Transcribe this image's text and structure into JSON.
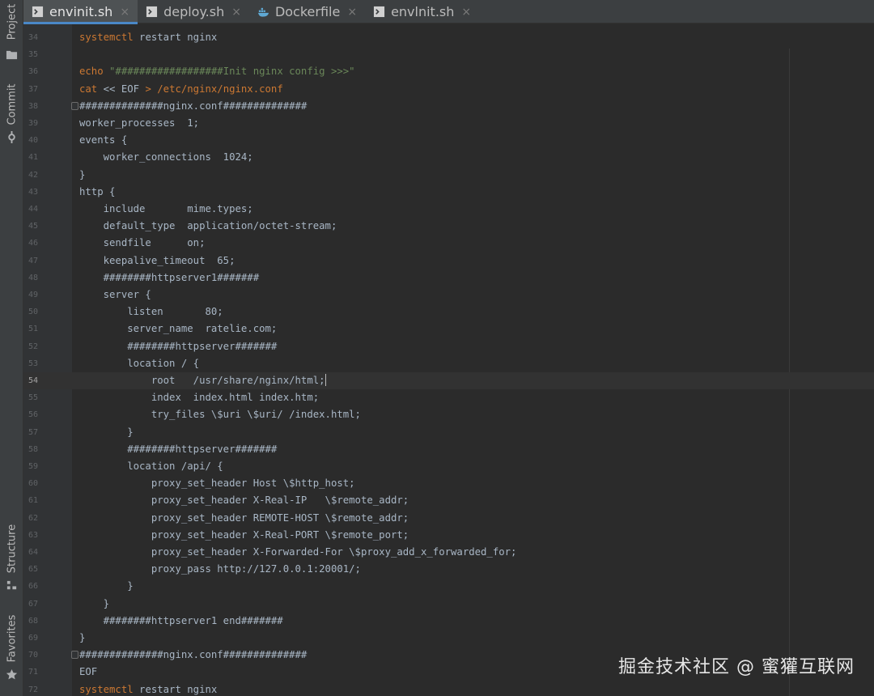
{
  "tabs": [
    {
      "label": "envinit.sh",
      "icon": "terminal-file-icon",
      "active": true
    },
    {
      "label": "deploy.sh",
      "icon": "terminal-file-icon",
      "active": false
    },
    {
      "label": "Dockerfile",
      "icon": "docker-file-icon",
      "active": false
    },
    {
      "label": "envlnit.sh",
      "icon": "terminal-file-icon",
      "active": false
    }
  ],
  "sidebar": {
    "project": "Project",
    "commit": "Commit",
    "structure": "Structure",
    "favorites": "Favorites"
  },
  "editor": {
    "current_line": 54,
    "lines": [
      {
        "n": "34",
        "parts": [
          {
            "t": "systemctl",
            "c": "kw"
          },
          {
            "t": " restart nginx",
            "c": ""
          }
        ]
      },
      {
        "n": "35",
        "parts": []
      },
      {
        "n": "36",
        "parts": [
          {
            "t": "echo",
            "c": "kw"
          },
          {
            "t": " \"##################Init nginx config >>>\"",
            "c": "str"
          }
        ]
      },
      {
        "n": "37",
        "parts": [
          {
            "t": "cat",
            "c": "kw"
          },
          {
            "t": " << EOF ",
            "c": ""
          },
          {
            "t": "> /etc/nginx/nginx.conf",
            "c": "kw"
          }
        ]
      },
      {
        "n": "38",
        "fold": true,
        "parts": [
          {
            "t": "##############nginx.conf##############",
            "c": ""
          }
        ]
      },
      {
        "n": "39",
        "parts": [
          {
            "t": "worker_processes  1;",
            "c": ""
          }
        ]
      },
      {
        "n": "40",
        "parts": [
          {
            "t": "events {",
            "c": ""
          }
        ]
      },
      {
        "n": "41",
        "parts": [
          {
            "t": "    worker_connections  1024;",
            "c": ""
          }
        ]
      },
      {
        "n": "42",
        "parts": [
          {
            "t": "}",
            "c": ""
          }
        ]
      },
      {
        "n": "43",
        "parts": [
          {
            "t": "http {",
            "c": ""
          }
        ]
      },
      {
        "n": "44",
        "parts": [
          {
            "t": "    include       mime.types;",
            "c": ""
          }
        ]
      },
      {
        "n": "45",
        "parts": [
          {
            "t": "    default_type  application/octet-stream;",
            "c": ""
          }
        ]
      },
      {
        "n": "46",
        "parts": [
          {
            "t": "    sendfile      on;",
            "c": ""
          }
        ]
      },
      {
        "n": "47",
        "parts": [
          {
            "t": "    keepalive_timeout  65;",
            "c": ""
          }
        ]
      },
      {
        "n": "48",
        "parts": [
          {
            "t": "    ########httpserver1#######",
            "c": ""
          }
        ]
      },
      {
        "n": "49",
        "parts": [
          {
            "t": "    server {",
            "c": ""
          }
        ]
      },
      {
        "n": "50",
        "parts": [
          {
            "t": "        listen       80;",
            "c": ""
          }
        ]
      },
      {
        "n": "51",
        "parts": [
          {
            "t": "        server_name  ratelie.com;",
            "c": ""
          }
        ]
      },
      {
        "n": "52",
        "parts": [
          {
            "t": "        ########httpserver#######",
            "c": ""
          }
        ]
      },
      {
        "n": "53",
        "parts": [
          {
            "t": "        location / {",
            "c": ""
          }
        ]
      },
      {
        "n": "54",
        "caret": true,
        "parts": [
          {
            "t": "            root   /usr/share/nginx/html;",
            "c": ""
          }
        ]
      },
      {
        "n": "55",
        "parts": [
          {
            "t": "            index  index.html index.htm;",
            "c": ""
          }
        ]
      },
      {
        "n": "56",
        "parts": [
          {
            "t": "            try_files \\$uri \\$uri/ /index.html;",
            "c": ""
          }
        ]
      },
      {
        "n": "57",
        "parts": [
          {
            "t": "        }",
            "c": ""
          }
        ]
      },
      {
        "n": "58",
        "parts": [
          {
            "t": "        ########httpserver#######",
            "c": ""
          }
        ]
      },
      {
        "n": "59",
        "parts": [
          {
            "t": "        location /api/ {",
            "c": ""
          }
        ]
      },
      {
        "n": "60",
        "parts": [
          {
            "t": "            proxy_set_header Host \\$http_host;",
            "c": ""
          }
        ]
      },
      {
        "n": "61",
        "parts": [
          {
            "t": "            proxy_set_header X-Real-IP   \\$remote_addr;",
            "c": ""
          }
        ]
      },
      {
        "n": "62",
        "parts": [
          {
            "t": "            proxy_set_header REMOTE-HOST \\$remote_addr;",
            "c": ""
          }
        ]
      },
      {
        "n": "63",
        "parts": [
          {
            "t": "            proxy_set_header X-Real-PORT \\$remote_port;",
            "c": ""
          }
        ]
      },
      {
        "n": "64",
        "parts": [
          {
            "t": "            proxy_set_header X-Forwarded-For \\$proxy_add_x_forwarded_for;",
            "c": ""
          }
        ]
      },
      {
        "n": "65",
        "parts": [
          {
            "t": "            proxy_pass http://127.0.0.1:20001/;",
            "c": ""
          }
        ]
      },
      {
        "n": "66",
        "parts": [
          {
            "t": "        }",
            "c": ""
          }
        ]
      },
      {
        "n": "67",
        "parts": [
          {
            "t": "    }",
            "c": ""
          }
        ]
      },
      {
        "n": "68",
        "parts": [
          {
            "t": "    ########httpserver1 end#######",
            "c": ""
          }
        ]
      },
      {
        "n": "69",
        "parts": [
          {
            "t": "}",
            "c": ""
          }
        ]
      },
      {
        "n": "70",
        "fold": true,
        "parts": [
          {
            "t": "##############nginx.conf##############",
            "c": ""
          }
        ]
      },
      {
        "n": "71",
        "parts": [
          {
            "t": "EOF",
            "c": "kw-plain"
          }
        ]
      },
      {
        "n": "72",
        "parts": [
          {
            "t": "systemctl",
            "c": "kw"
          },
          {
            "t": " restart nginx",
            "c": ""
          }
        ]
      }
    ]
  },
  "watermark": "掘金技术社区 @ 蜜獾互联网",
  "colors": {
    "keyword": "#cc7832",
    "string": "#6a8759",
    "text": "#a9b7c6",
    "active_tab_underline": "#4a88c7"
  }
}
